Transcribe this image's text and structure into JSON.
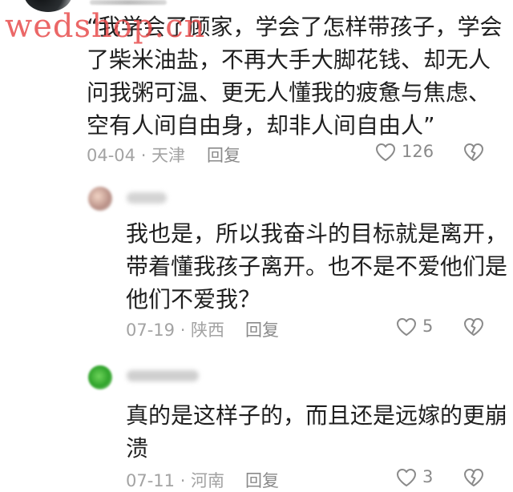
{
  "watermark": "wedshop.cn",
  "comments": [
    {
      "lines": [
        "“我学会了顾家，学会了怎样带孩子，学会",
        "了柴米油盐，不再大手大脚花钱、却无人",
        "问我粥可温、更无人懂我的疲惫与焦虑、",
        "空有人间自由身，却非人间自由人”"
      ],
      "date_location": "04-04 · 天津",
      "reply_label": "回复",
      "like_count": "126"
    },
    {
      "lines": [
        "我也是，所以我奋斗的目标就是离开，",
        "带着懂我孩子离开。也不是不爱他们是",
        "他们不爱我？"
      ],
      "date_location": "07-19 · 陕西",
      "reply_label": "回复",
      "like_count": "5"
    },
    {
      "lines": [
        "真的是这样子的，而且还是远嫁的更崩",
        "溃"
      ],
      "date_location": "07-11 · 河南",
      "reply_label": "回复",
      "like_count": "3"
    }
  ],
  "icons": {
    "like": "heart-outline-icon",
    "dislike": "broken-heart-icon"
  },
  "colors": {
    "text": "#1f1f1f",
    "meta": "#9a9a9a",
    "watermark": "#e84c4c",
    "icon": "#8a8a8a"
  }
}
